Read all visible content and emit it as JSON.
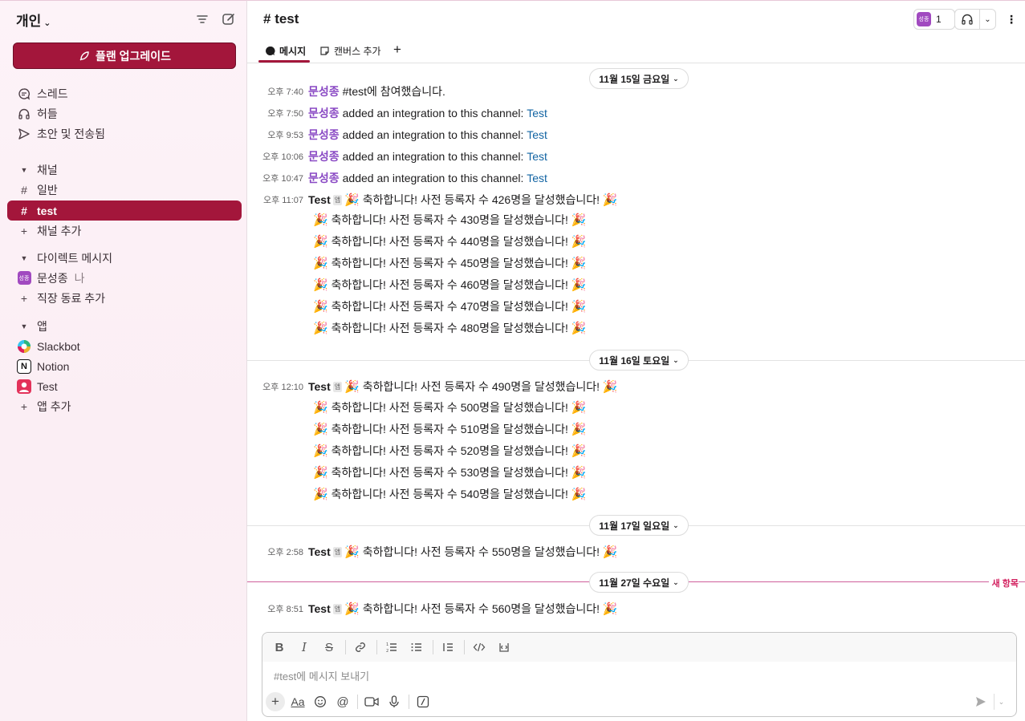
{
  "sidebar": {
    "workspace": "개인",
    "upgrade_label": "플랜 업그레이드",
    "top_items": [
      "스레드",
      "허들",
      "초안 및 전송됨"
    ],
    "channels_header": "채널",
    "channels": [
      "일반",
      "test"
    ],
    "add_channel": "채널 추가",
    "dm_header": "다이렉트 메시지",
    "dm_user": "문성종",
    "dm_user_suffix": "나",
    "dm_avatar": "성종",
    "add_coworker": "직장 동료 추가",
    "apps_header": "앱",
    "apps": [
      "Slackbot",
      "Notion",
      "Test"
    ],
    "add_app": "앱 추가"
  },
  "header": {
    "channel": "test",
    "members_avatar": "성종",
    "members_count": "1",
    "tabs": [
      "메시지",
      "캔버스 추가"
    ]
  },
  "dates": [
    "11월 15일 금요일",
    "11월 16일 토요일",
    "11월 17일 일요일",
    "11월 27일 수요일"
  ],
  "new_label": "새 항목",
  "app_badge": "앱",
  "messages": {
    "m1": {
      "time": "오후 7:40",
      "user": "문성종",
      "text": "#test에 참여했습니다."
    },
    "integration_text": "added an integration to this channel:",
    "integration_link": "Test",
    "m2_time": "오후 7:50",
    "m3_time": "오후 9:53",
    "m4_time": "오후 10:06",
    "m5_time": "오후 10:47",
    "bot_name": "Test",
    "m6": {
      "time": "오후 11:07",
      "text": "축하합니다! 사전 등록자 수 426명을 달성했습니다!"
    },
    "m6_cont": [
      "축하합니다! 사전 등록자 수 430명을 달성했습니다!",
      "축하합니다! 사전 등록자 수 440명을 달성했습니다!",
      "축하합니다! 사전 등록자 수 450명을 달성했습니다!",
      "축하합니다! 사전 등록자 수 460명을 달성했습니다!",
      "축하합니다! 사전 등록자 수 470명을 달성했습니다!",
      "축하합니다! 사전 등록자 수 480명을 달성했습니다!"
    ],
    "m7": {
      "time": "오후 12:10",
      "text": "축하합니다! 사전 등록자 수 490명을 달성했습니다!"
    },
    "m7_cont": [
      "축하합니다! 사전 등록자 수 500명을 달성했습니다!",
      "축하합니다! 사전 등록자 수 510명을 달성했습니다!",
      "축하합니다! 사전 등록자 수 520명을 달성했습니다!",
      "축하합니다! 사전 등록자 수 530명을 달성했습니다!",
      "축하합니다! 사전 등록자 수 540명을 달성했습니다!"
    ],
    "m8": {
      "time": "오후 2:58",
      "text": "축하합니다! 사전 등록자 수 550명을 달성했습니다!"
    },
    "m9": {
      "time": "오후 8:51",
      "text": "축하합니다! 사전 등록자 수 560명을 달성했습니다!"
    }
  },
  "composer": {
    "placeholder": "#test에 메시지 보내기"
  },
  "colors": {
    "accent": "#a3163b",
    "user": "#8a4ac4",
    "link": "#1264a3",
    "new": "#d21f5e"
  }
}
